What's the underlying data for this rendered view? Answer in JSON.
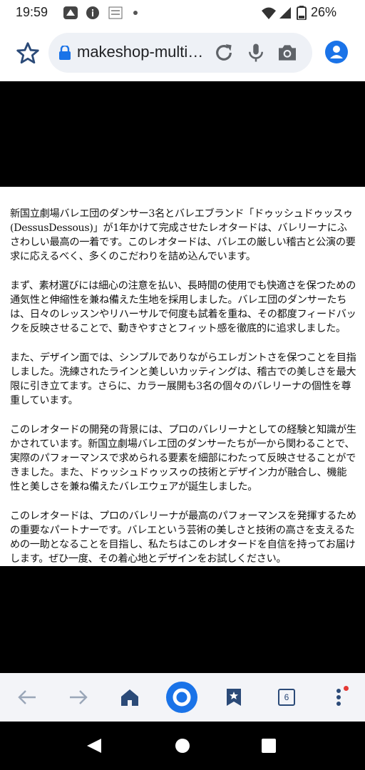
{
  "status_bar": {
    "time": "19:59",
    "battery": "26%",
    "icons": [
      "app-notification-icon",
      "info-icon",
      "app-badge-icon",
      "wifi-icon",
      "cell-signal-icon",
      "battery-icon"
    ]
  },
  "toolbar": {
    "url": "makeshop-multi…",
    "icons": [
      "star-icon",
      "lock-icon",
      "refresh-icon",
      "mic-icon",
      "camera-icon",
      "account-icon"
    ]
  },
  "article": {
    "paragraphs": [
      "新国立劇場バレエ団のダンサー3名とバレエブランド「ドゥッシュドゥッスゥ(DessusDessous)」が1年かけて完成させたレオタードは、バレリーナにふさわしい最高の一着です。このレオタードは、バレエの厳しい稽古と公演の要求に応えるべく、多くのこだわりを詰め込んでいます。",
      "まず、素材選びには細心の注意を払い、長時間の使用でも快適さを保つための通気性と伸縮性を兼ね備えた生地を採用しました。バレエ団のダンサーたちは、日々のレッスンやリハーサルで何度も試着を重ね、その都度フィードバックを反映させることで、動きやすさとフィット感を徹底的に追求しました。",
      "また、デザイン面では、シンプルでありながらエレガントさを保つことを目指しました。洗練されたラインと美しいカッティングは、稽古での美しさを最大限に引き立てます。さらに、カラー展開も3名の個々のバレリーナの個性を尊重しています。",
      "このレオタードの開発の背景には、プロのバレリーナとしての経験と知識が生かされています。新国立劇場バレエ団のダンサーたちが一から関わることで、実際のパフォーマンスで求められる要素を細部にわたって反映させることができました。また、ドゥッシュドゥッスゥの技術とデザイン力が融合し、機能性と美しさを兼ね備えたバレエウェアが誕生しました。",
      "このレオタードは、プロのバレリーナが最高のパフォーマンスを発揮するための重要なパートナーです。バレエという芸術の美しさと技術の高さを支えるための一助となることを目指し、私たちはこのレオタードを自信を持ってお届けします。ぜひ一度、その着心地とデザインをお試しください。"
    ]
  },
  "bottom_nav": {
    "tab_count": "6",
    "accent_color": "#1a73e8",
    "icons": [
      "back-icon",
      "forward-icon",
      "home-icon",
      "search-icon",
      "bookmarks-icon",
      "tabs-icon",
      "menu-icon"
    ]
  },
  "system_nav": {
    "icons": [
      "back-triangle-icon",
      "home-circle-icon",
      "recents-square-icon"
    ]
  }
}
